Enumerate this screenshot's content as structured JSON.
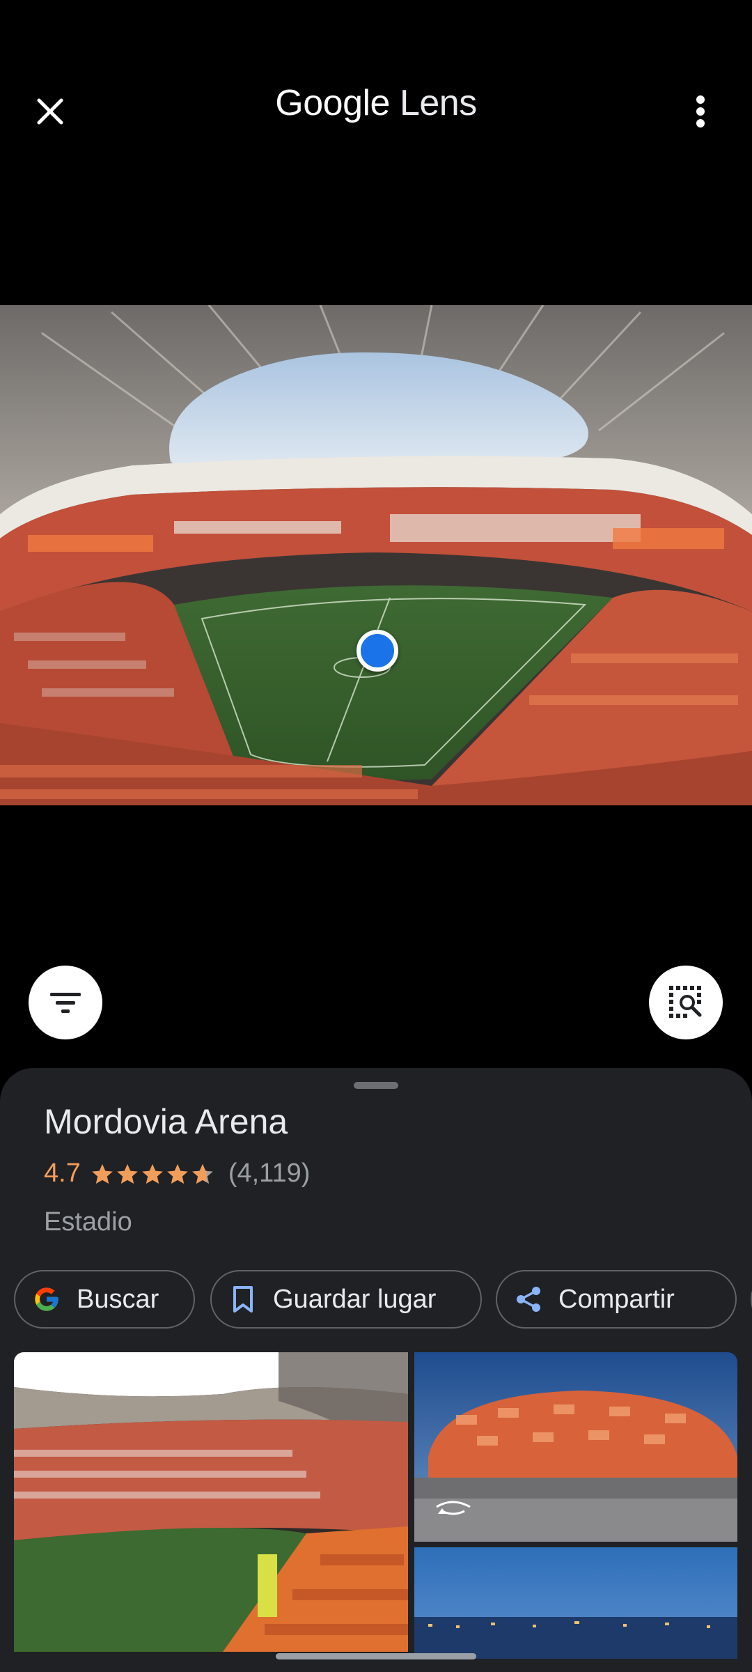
{
  "header": {
    "title_brand": "Google",
    "title_product": "Lens",
    "close_icon": "close-icon",
    "more_icon": "more-vert-icon"
  },
  "main_image": {
    "alt": "stadium",
    "focus_marker": "blue-dot"
  },
  "fabs": {
    "filter_icon": "filter-icon",
    "select_icon": "image-search-select-icon"
  },
  "result": {
    "name": "Mordovia Arena",
    "rating": "4.7",
    "stars": 4.7,
    "review_count": "(4,119)",
    "category": "Estadio"
  },
  "chips": [
    {
      "label": "Buscar",
      "icon": "google-g-icon"
    },
    {
      "label": "Guardar lugar",
      "icon": "bookmark-icon"
    },
    {
      "label": "Compartir",
      "icon": "share-icon"
    }
  ],
  "colors": {
    "accent_blue": "#1a73e8",
    "rating_orange": "#f29e5b",
    "sheet_bg": "#202124"
  }
}
